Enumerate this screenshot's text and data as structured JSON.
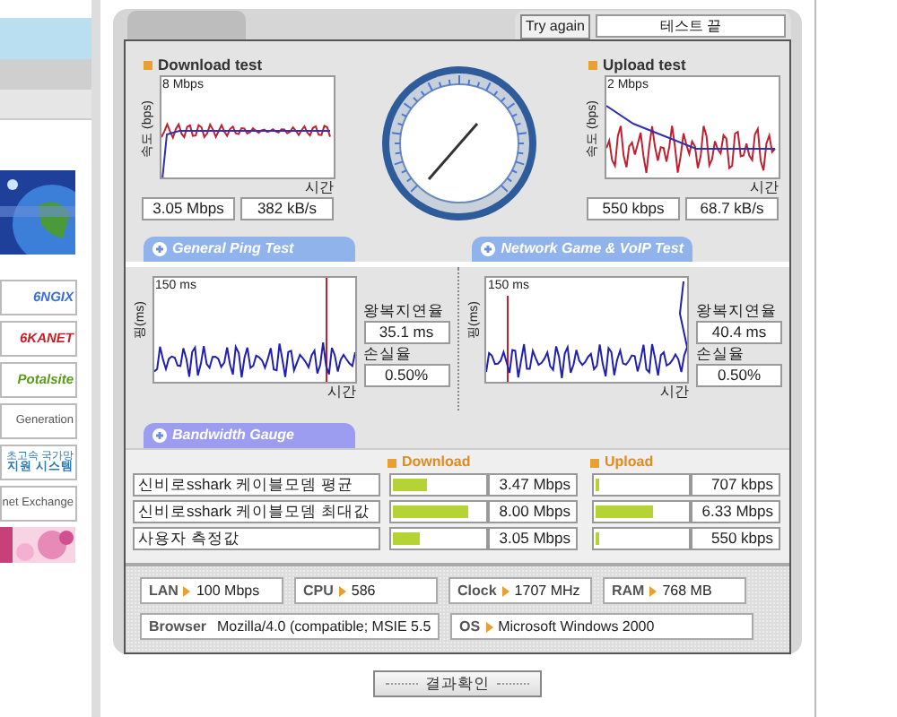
{
  "sidebar": {
    "banners": [
      {
        "kind": "picture"
      },
      {
        "kind": "logo",
        "text": "6NGIX",
        "color": "#3b6fd4"
      },
      {
        "kind": "logo",
        "text": "6KANET",
        "color": "#c8202a"
      },
      {
        "kind": "logo",
        "text": "Potalsite",
        "color": "#5a9a1a"
      },
      {
        "kind": "plain",
        "text": "Generation",
        "color": "#555555"
      },
      {
        "kind": "logo2",
        "text": "초고속 국가망",
        "text2": "지원 시스템",
        "color": "#2a7ab8"
      },
      {
        "kind": "plain",
        "text": "net Exchange",
        "color": "#555555"
      },
      {
        "kind": "picture"
      }
    ]
  },
  "header": {
    "try_again_button": "Try again",
    "status_field": "테스트 끝"
  },
  "speed_tests": [
    {
      "title": "Download test",
      "y_label": "속도 (bps)",
      "scale": "8 Mbps",
      "x_label": "시간",
      "readings": [
        "3.05 Mbps",
        "382 kB/s"
      ]
    },
    {
      "title": "Upload test",
      "y_label": "속도 (bps)",
      "scale": "2 Mbps",
      "x_label": "시간",
      "readings": [
        "550 kbps",
        "68.7 kB/s"
      ]
    }
  ],
  "section_tabs": [
    {
      "label": "General Ping Test",
      "selected": false
    },
    {
      "label": "Network Game & VoIP Test",
      "selected": false
    },
    {
      "label": "Bandwidth Gauge",
      "selected": true
    }
  ],
  "ping_tests": [
    {
      "y_label": "핑(ms)",
      "scale": "150 ms",
      "x_label": "시간",
      "delay_label": "왕복지연율",
      "delay": "35.1 ms",
      "loss_label": "손실율",
      "loss": "0.50%"
    },
    {
      "y_label": "핑(ms)",
      "scale": "150 ms",
      "x_label": "시간",
      "delay_label": "왕복지연율",
      "delay": "40.4 ms",
      "loss_label": "손실율",
      "loss": "0.50%"
    }
  ],
  "bandwidth": {
    "download_header": "Download",
    "upload_header": "Upload",
    "rows": [
      {
        "label": "신비로sshark 케이블모뎀 평균",
        "download": {
          "level": 0.37,
          "reading": "3.47 Mbps"
        },
        "upload": {
          "level": 0.04,
          "reading": "707 kbps"
        }
      },
      {
        "label": "신비로sshark 케이블모뎀 최대값",
        "download": {
          "level": 0.82,
          "reading": "8.00 Mbps"
        },
        "upload": {
          "level": 0.62,
          "reading": "6.33 Mbps"
        }
      },
      {
        "label": "사용자 측정값",
        "download": {
          "level": 0.3,
          "reading": "3.05 Mbps"
        },
        "upload": {
          "level": 0.04,
          "reading": "550 kbps"
        }
      }
    ]
  },
  "system_info": [
    [
      {
        "label": "LAN",
        "value": "100 Mbps"
      },
      {
        "label": "CPU",
        "value": "586"
      },
      {
        "label": "Clock",
        "value": "1707 MHz"
      },
      {
        "label": "RAM",
        "value": "768 MB"
      }
    ],
    [
      {
        "label": "Browser",
        "value": "Mozilla/4.0 (compatible; MSIE 5.5"
      },
      {
        "label": "OS",
        "value": "Microsoft Windows 2000"
      }
    ]
  ],
  "confirm_button": "결과확인"
}
